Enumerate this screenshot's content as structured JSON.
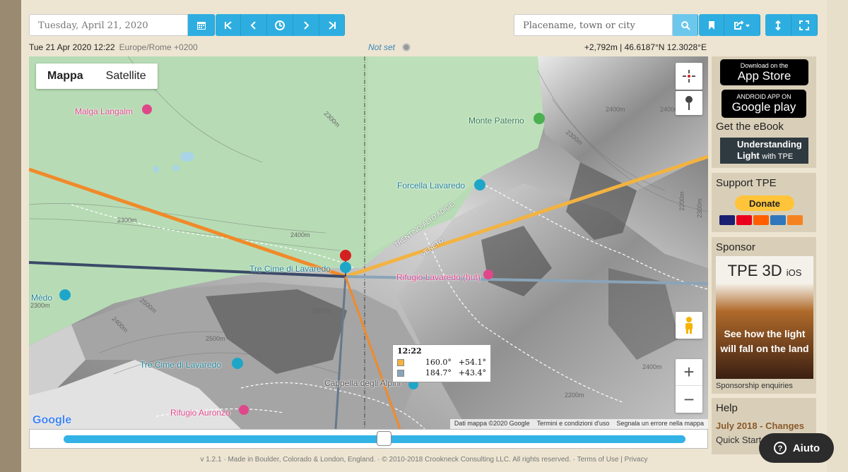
{
  "toolbar": {
    "date_placeholder": "Tuesday, April 21, 2020",
    "place_placeholder": "Placename, town or city"
  },
  "info": {
    "datetime": "Tue 21 Apr 2020 12:22",
    "timezone": "Europe/Rome +0200",
    "not_set": "Not set",
    "coords": "+2,792m | 46.6187°N 12.3028°E"
  },
  "map": {
    "type_map": "Mappa",
    "type_satellite": "Satellite",
    "labels": {
      "malga": "Malga Langalm",
      "paterno": "Monte Paterno",
      "forcella": "Forcella Lavaredo",
      "tre_cime_top": "Tre Cime di Lavaredo",
      "rifugio_lavaredo": "Rifugio Lavaredo (hut)",
      "medo": "Mèdo",
      "tre_cime_bottom": "Tre Cime di Lavaredo",
      "cappella": "Cappella degli Alpini",
      "auronzo": "Rifugio Auronzo",
      "trentino": "TRENTINO-ALTO ADIGE",
      "veneto": "VENETO"
    },
    "contours": [
      "2300m",
      "2400m",
      "2300m",
      "2400m",
      "2300m",
      "2500m",
      "2600m",
      "2500m",
      "2400m",
      "2300m",
      "2400m",
      "2200m",
      "2300m",
      "2400m",
      "2200m"
    ],
    "google": "Google",
    "attribution": {
      "data": "Dati mappa ©2020 Google",
      "terms": "Termini e condizioni d'uso",
      "report": "Segnala un errore nella mappa"
    }
  },
  "popup": {
    "time": "12:22",
    "rows": [
      {
        "color": "#f3b340",
        "az": "160.0°",
        "alt": "+54.1°"
      },
      {
        "color": "#8aa4b8",
        "az": "184.7°",
        "alt": "+43.4°"
      }
    ]
  },
  "sidebar": {
    "appstore_small": "Download on the",
    "appstore_big": "App Store",
    "gplay_small": "ANDROID APP ON",
    "gplay_big": "Google play",
    "ebook_title": "Get the eBook",
    "ebook_l1": "Understanding",
    "ebook_l2": "Light",
    "ebook_l3": "with TPE",
    "support_title": "Support TPE",
    "donate": "Donate",
    "sponsor_title": "Sponsor",
    "ad_title": "TPE 3D",
    "ad_ios": "iOS",
    "ad_caption": "See how the light will fall on the land",
    "sponsorship": "Sponsorship enquiries",
    "help_title": "Help",
    "help_link1": "July 2018 - Changes",
    "help_link2": "Quick Start"
  },
  "footer": {
    "version": "v 1.2.1",
    "made": "Made in Boulder, Colorado & London, England.",
    "copyright": "© 2010-2018 Crookneck Consulting LLC. All rights reserved.",
    "terms": "Terms of Use",
    "privacy": "Privacy"
  },
  "aiuto": "Aiuto"
}
